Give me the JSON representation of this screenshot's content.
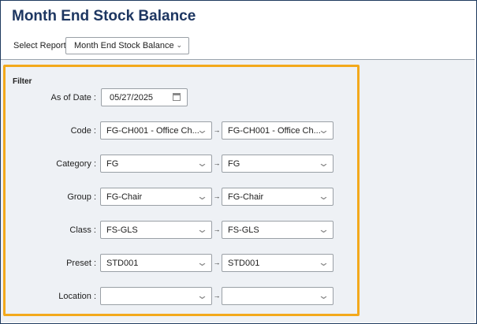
{
  "header": {
    "title": "Month End Stock Balance",
    "report_label": "Select Report:",
    "report_value": "Month End Stock Balance"
  },
  "filter": {
    "title": "Filter",
    "as_of_date_label": "As of Date :",
    "as_of_date_value": "05/27/2025",
    "rows": [
      {
        "label": "Code :",
        "from": "FG-CH001 - Office Ch...",
        "to": "FG-CH001 - Office Ch..."
      },
      {
        "label": "Category :",
        "from": "FG",
        "to": "FG"
      },
      {
        "label": "Group :",
        "from": "FG-Chair",
        "to": "FG-Chair"
      },
      {
        "label": "Class :",
        "from": "FS-GLS",
        "to": "FS-GLS"
      },
      {
        "label": "Preset :",
        "from": "STD001",
        "to": "STD001"
      },
      {
        "label": "Location :",
        "from": "",
        "to": ""
      }
    ]
  },
  "colors": {
    "title": "#1d3661",
    "highlight_border": "#f3a91c",
    "panel_background": "#eef1f5"
  }
}
